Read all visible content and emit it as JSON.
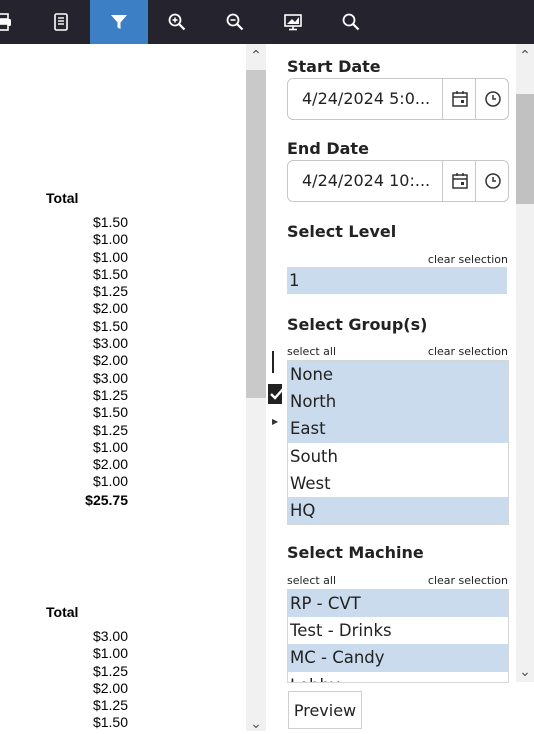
{
  "toolbar": {
    "buttons": [
      {
        "icon": "print-icon",
        "active": false
      },
      {
        "icon": "document-icon",
        "active": false
      },
      {
        "icon": "filter-icon",
        "active": true
      },
      {
        "icon": "zoom-in-icon",
        "active": false
      },
      {
        "icon": "zoom-out-icon",
        "active": false
      },
      {
        "icon": "presentation-icon",
        "active": false
      },
      {
        "icon": "search-icon",
        "active": false
      }
    ],
    "active_color": "#3d7fc4",
    "bg_color": "#25232e"
  },
  "report": {
    "blocks": [
      {
        "title": "Total",
        "values": [
          "$1.50",
          "$1.00",
          "$1.00",
          "$1.50",
          "$1.25",
          "$2.00",
          "$1.50",
          "$3.00",
          "$2.00",
          "$3.00",
          "$1.25",
          "$1.50",
          "$1.25",
          "$1.00",
          "$2.00",
          "$1.00"
        ],
        "total": "$25.75"
      },
      {
        "title": "Total",
        "values": [
          "$3.00",
          "$1.00",
          "$1.25",
          "$2.00",
          "$1.25",
          "$1.50"
        ],
        "total": ""
      }
    ]
  },
  "filters": {
    "start_date": {
      "label": "Start Date",
      "value": "4/24/2024 5:0..."
    },
    "end_date": {
      "label": "End Date",
      "value": "4/24/2024 10:..."
    },
    "level": {
      "label": "Select Level",
      "clear": "clear selection",
      "options": [
        {
          "text": "1",
          "selected": true
        }
      ]
    },
    "groups": {
      "label": "Select Group(s)",
      "select_all": "select all",
      "clear": "clear selection",
      "options": [
        {
          "text": "None",
          "selected": true
        },
        {
          "text": "North",
          "selected": true
        },
        {
          "text": "East",
          "selected": true
        },
        {
          "text": "South",
          "selected": false
        },
        {
          "text": "West",
          "selected": false
        },
        {
          "text": "HQ",
          "selected": true
        }
      ]
    },
    "machine": {
      "label": "Select Machine",
      "select_all": "select all",
      "clear": "clear selection",
      "options": [
        {
          "text": "RP - CVT",
          "selected": true
        },
        {
          "text": "Test - Drinks",
          "selected": false
        },
        {
          "text": "MC - Candy",
          "selected": true
        },
        {
          "text": "Lobby",
          "selected": false
        }
      ]
    },
    "preview_label": "Preview",
    "selected_color": "#c9dbec"
  }
}
